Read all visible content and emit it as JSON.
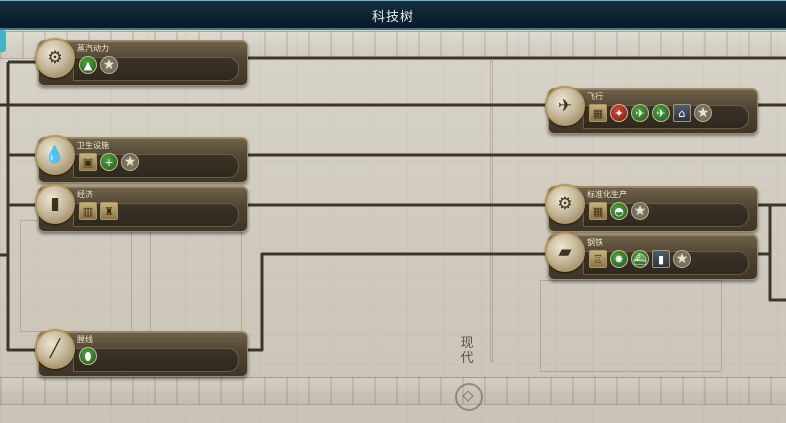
{
  "window": {
    "title": "科技树"
  },
  "era": {
    "label": "现代"
  },
  "techs": [
    {
      "id": "steam",
      "name": "蒸汽动力",
      "portrait_icon": "engine-icon",
      "portrait_glyph": "⚙",
      "unlocks": [
        {
          "icon": "landscape-icon",
          "glyph": "▲",
          "style": "circle green"
        },
        {
          "icon": "star-icon",
          "glyph": "★",
          "style": "star"
        }
      ]
    },
    {
      "id": "flight",
      "name": "飞行",
      "portrait_icon": "airplane-icon",
      "portrait_glyph": "✈",
      "unlocks": [
        {
          "icon": "building-icon",
          "glyph": "▦",
          "style": "square tan"
        },
        {
          "icon": "great-work-icon",
          "glyph": "✦",
          "style": "circle red"
        },
        {
          "icon": "biplane-icon",
          "glyph": "✈",
          "style": "circle green"
        },
        {
          "icon": "fighter-icon",
          "glyph": "✈",
          "style": "circle green"
        },
        {
          "icon": "observatory-icon",
          "glyph": "⌂",
          "style": "square slate"
        },
        {
          "icon": "star-icon",
          "glyph": "★",
          "style": "star"
        }
      ]
    },
    {
      "id": "sanitation",
      "name": "卫生设施",
      "portrait_icon": "water-drop-icon",
      "portrait_glyph": "💧",
      "unlocks": [
        {
          "icon": "building-icon",
          "glyph": "▣",
          "style": "square tan"
        },
        {
          "icon": "health-plus-icon",
          "glyph": "+",
          "style": "circle green"
        },
        {
          "icon": "star-icon",
          "glyph": "★",
          "style": "star"
        }
      ]
    },
    {
      "id": "economics",
      "name": "经济",
      "portrait_icon": "bar-chart-icon",
      "portrait_glyph": "▮",
      "unlocks": [
        {
          "icon": "stock-exchange-icon",
          "glyph": "▥",
          "style": "square tan"
        },
        {
          "icon": "wonder-tower-icon",
          "glyph": "♜",
          "style": "square tan"
        }
      ]
    },
    {
      "id": "mass-production",
      "name": "标准化生产",
      "portrait_icon": "gears-icon",
      "portrait_glyph": "⚙",
      "unlocks": [
        {
          "icon": "factory-icon",
          "glyph": "▦",
          "style": "square tan"
        },
        {
          "icon": "helmet-icon",
          "glyph": "◓",
          "style": "circle green"
        },
        {
          "icon": "star-icon",
          "glyph": "★",
          "style": "star"
        }
      ]
    },
    {
      "id": "steel",
      "name": "钢铁",
      "portrait_icon": "steel-beam-icon",
      "portrait_glyph": "▰",
      "unlocks": [
        {
          "icon": "tower-icon",
          "glyph": "♖",
          "style": "square tan"
        },
        {
          "icon": "artillery-icon",
          "glyph": "✸",
          "style": "circle green"
        },
        {
          "icon": "battleship-icon",
          "glyph": "⛴",
          "style": "circle green"
        },
        {
          "icon": "flag-icon",
          "glyph": "▮",
          "style": "square slate"
        },
        {
          "icon": "star-icon",
          "glyph": "★",
          "style": "star"
        }
      ]
    },
    {
      "id": "rifling",
      "name": "膛线",
      "portrait_icon": "rifle-icon",
      "portrait_glyph": "╱",
      "unlocks": [
        {
          "icon": "infantry-icon",
          "glyph": "⬮",
          "style": "circle green"
        }
      ]
    }
  ]
}
